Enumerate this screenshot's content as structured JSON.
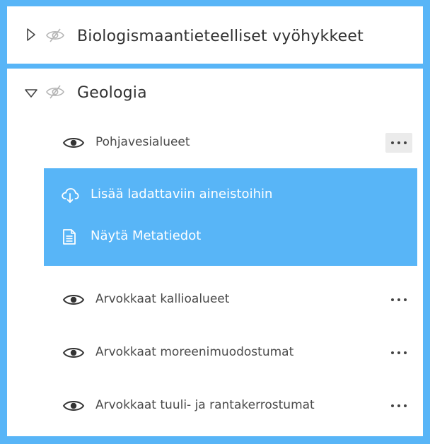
{
  "groups": [
    {
      "title": "Biologismaantieteelliset vyöhykkeet",
      "expanded": false
    },
    {
      "title": "Geologia",
      "expanded": true,
      "layers": [
        {
          "label": "Pohjavesialueet",
          "menu_open": true
        },
        {
          "label": "Arvokkaat kallioalueet",
          "menu_open": false
        },
        {
          "label": "Arvokkaat moreenimuodostumat",
          "menu_open": false
        },
        {
          "label": "Arvokkaat tuuli- ja rantakerrostumat",
          "menu_open": false
        }
      ]
    }
  ],
  "context_menu": {
    "items": [
      {
        "label": "Lisää ladattaviin aineistoihin",
        "icon": "cloud-download-icon"
      },
      {
        "label": "Näytä Metatiedot",
        "icon": "document-icon"
      }
    ]
  },
  "colors": {
    "accent": "#58b5f7",
    "text": "#333333",
    "icon_muted": "#b5b5b5"
  }
}
